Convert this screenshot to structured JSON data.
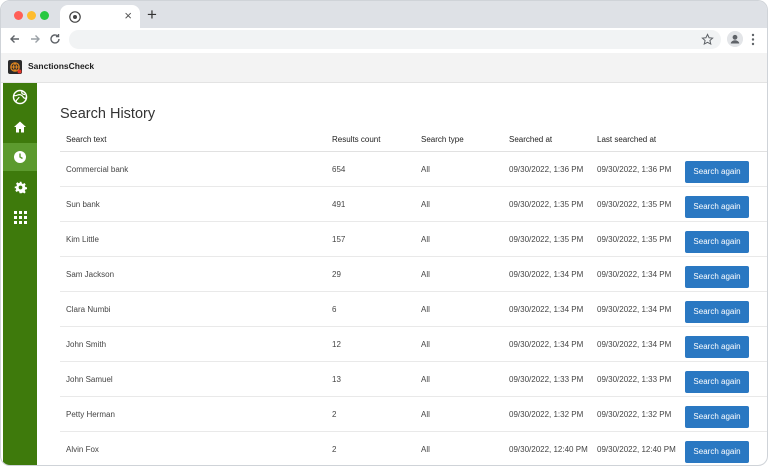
{
  "app": {
    "name": "SanctionsCheck"
  },
  "browser": {
    "tab_close": "×",
    "new_tab": "+"
  },
  "page": {
    "title": "Search History"
  },
  "table": {
    "columns": [
      "Search text",
      "Results count",
      "Search type",
      "Searched at",
      "Last searched at"
    ],
    "button_label": "Search again",
    "rows": [
      {
        "text": "Commercial bank",
        "count": "654",
        "type": "All",
        "searched": "09/30/2022, 1:36 PM",
        "last": "09/30/2022, 1:36 PM"
      },
      {
        "text": "Sun bank",
        "count": "491",
        "type": "All",
        "searched": "09/30/2022, 1:35 PM",
        "last": "09/30/2022, 1:35 PM"
      },
      {
        "text": "Kim Little",
        "count": "157",
        "type": "All",
        "searched": "09/30/2022, 1:35 PM",
        "last": "09/30/2022, 1:35 PM"
      },
      {
        "text": "Sam Jackson",
        "count": "29",
        "type": "All",
        "searched": "09/30/2022, 1:34 PM",
        "last": "09/30/2022, 1:34 PM"
      },
      {
        "text": "Clara Numbi",
        "count": "6",
        "type": "All",
        "searched": "09/30/2022, 1:34 PM",
        "last": "09/30/2022, 1:34 PM"
      },
      {
        "text": "John Smith",
        "count": "12",
        "type": "All",
        "searched": "09/30/2022, 1:34 PM",
        "last": "09/30/2022, 1:34 PM"
      },
      {
        "text": "John Samuel",
        "count": "13",
        "type": "All",
        "searched": "09/30/2022, 1:33 PM",
        "last": "09/30/2022, 1:33 PM"
      },
      {
        "text": "Petty Herman",
        "count": "2",
        "type": "All",
        "searched": "09/30/2022, 1:32 PM",
        "last": "09/30/2022, 1:32 PM"
      },
      {
        "text": "Alvin Fox",
        "count": "2",
        "type": "All",
        "searched": "09/30/2022, 12:40 PM",
        "last": "09/30/2022, 12:40 PM"
      }
    ]
  },
  "sidebar": {
    "items": [
      {
        "icon": "globe-icon"
      },
      {
        "icon": "home-icon"
      },
      {
        "icon": "clock-icon",
        "active": true
      },
      {
        "icon": "gear-icon"
      },
      {
        "icon": "apps-grid-icon"
      }
    ]
  },
  "colors": {
    "sidebar": "#3e7a0c",
    "sidebar_active": "#5c9a2e",
    "button": "#2a78c2"
  }
}
